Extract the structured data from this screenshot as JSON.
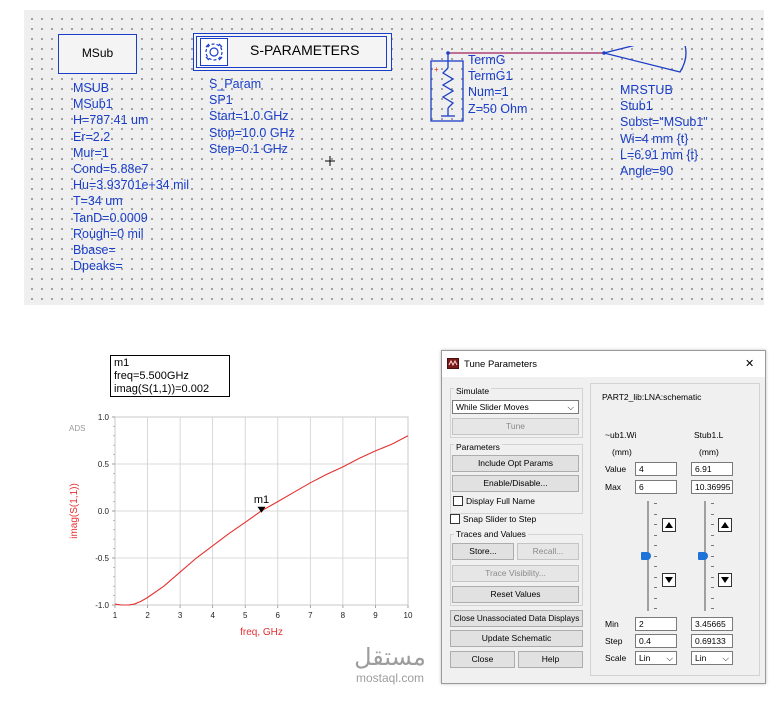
{
  "schematic": {
    "msub": {
      "box_label": "MSub",
      "params": [
        "MSUB",
        "MSub1",
        "H=787.41 um",
        "Er=2.2",
        "Mur=1",
        "Cond=5.88e7",
        "Hu=3.93701e+34 mil",
        "T=34 um",
        "TanD=0.0009",
        "Rough=0 mil",
        "Bbase=",
        "Dpeaks="
      ]
    },
    "sparam": {
      "box_label": "S-PARAMETERS",
      "params": [
        "S_Param",
        "SP1",
        "Start=1.0 GHz",
        "Stop=10.0 GHz",
        "Step=0.1 GHz"
      ]
    },
    "term": {
      "params": [
        "TermG",
        "TermG1",
        "Num=1",
        "Z=50 Ohm"
      ]
    },
    "stub": {
      "params": [
        "MRSTUB",
        "Stub1",
        "Subst=\"MSub1\"",
        "Wi=4 mm {t}",
        "L=6.91 mm {t}",
        "Angle=90"
      ]
    }
  },
  "marker_box": {
    "lines": [
      "m1",
      "freq=5.500GHz",
      "imag(S(1,1))=0.002"
    ]
  },
  "chart_data": {
    "type": "line",
    "ads_label": "ADS",
    "xlabel": "freq, GHz",
    "ylabel": "imag(S(1,1))",
    "xlim": [
      1,
      10
    ],
    "ylim": [
      -1.0,
      1.0
    ],
    "xticks": [
      "1",
      "2",
      "3",
      "4",
      "5",
      "6",
      "7",
      "8",
      "9",
      "10"
    ],
    "yticks": [
      "-1.0",
      "-0.5",
      "0.0",
      "0.5",
      "1.0"
    ],
    "grid": true,
    "series": [
      {
        "color": "#e53030",
        "x": [
          1.0,
          1.2,
          1.4,
          1.6,
          1.8,
          2.0,
          2.5,
          3.0,
          3.5,
          4.0,
          4.5,
          5.0,
          5.5,
          6.0,
          6.5,
          7.0,
          7.5,
          8.0,
          8.5,
          9.0,
          9.5,
          10.0
        ],
        "y": [
          -0.99,
          -1.0,
          -1.0,
          -0.99,
          -0.96,
          -0.92,
          -0.8,
          -0.65,
          -0.5,
          -0.37,
          -0.24,
          -0.12,
          0.002,
          0.1,
          0.2,
          0.3,
          0.39,
          0.47,
          0.56,
          0.64,
          0.71,
          0.8
        ]
      }
    ],
    "marker": {
      "label": "m1",
      "x": 5.5,
      "y": 0.002
    }
  },
  "dialog": {
    "title": "Tune Parameters",
    "close_glyph": "✕",
    "simulate_group": "Simulate",
    "simulate_mode": "While Slider Moves",
    "tune_button": "Tune",
    "parameters_group": "Parameters",
    "include_opt_button": "Include Opt Params",
    "enable_disable_button": "Enable/Disable...",
    "display_full_name_label": "Display Full Name",
    "display_full_name_checked": false,
    "snap_slider_label": "Snap Slider to Step",
    "snap_slider_checked": false,
    "traces_group": "Traces and Values",
    "store_button": "Store...",
    "recall_button": "Recall...",
    "trace_visibility_button": "Trace Visibility...",
    "reset_values_button": "Reset Values",
    "close_unassociated_button": "Close Unassociated Data Displays",
    "update_schematic_button": "Update Schematic",
    "close_button": "Close",
    "help_button": "Help",
    "schematic_path": "PART2_lib:LNA:schematic",
    "row_labels": {
      "value": "Value",
      "max": "Max",
      "min": "Min",
      "step": "Step",
      "scale": "Scale"
    },
    "params": [
      {
        "name": "~ub1.Wi",
        "unit": "(mm)",
        "value": "4",
        "max": "6",
        "min": "2",
        "step": "0.4",
        "scale": "Lin",
        "slider_fraction": 0.5
      },
      {
        "name": "Stub1.L",
        "unit": "(mm)",
        "value": "6.91",
        "max": "10.36995",
        "min": "3.45665",
        "step": "0.69133",
        "scale": "Lin",
        "slider_fraction": 0.5
      }
    ]
  },
  "watermark": {
    "arabic": "مستقل",
    "latin": "mostaql.com"
  }
}
